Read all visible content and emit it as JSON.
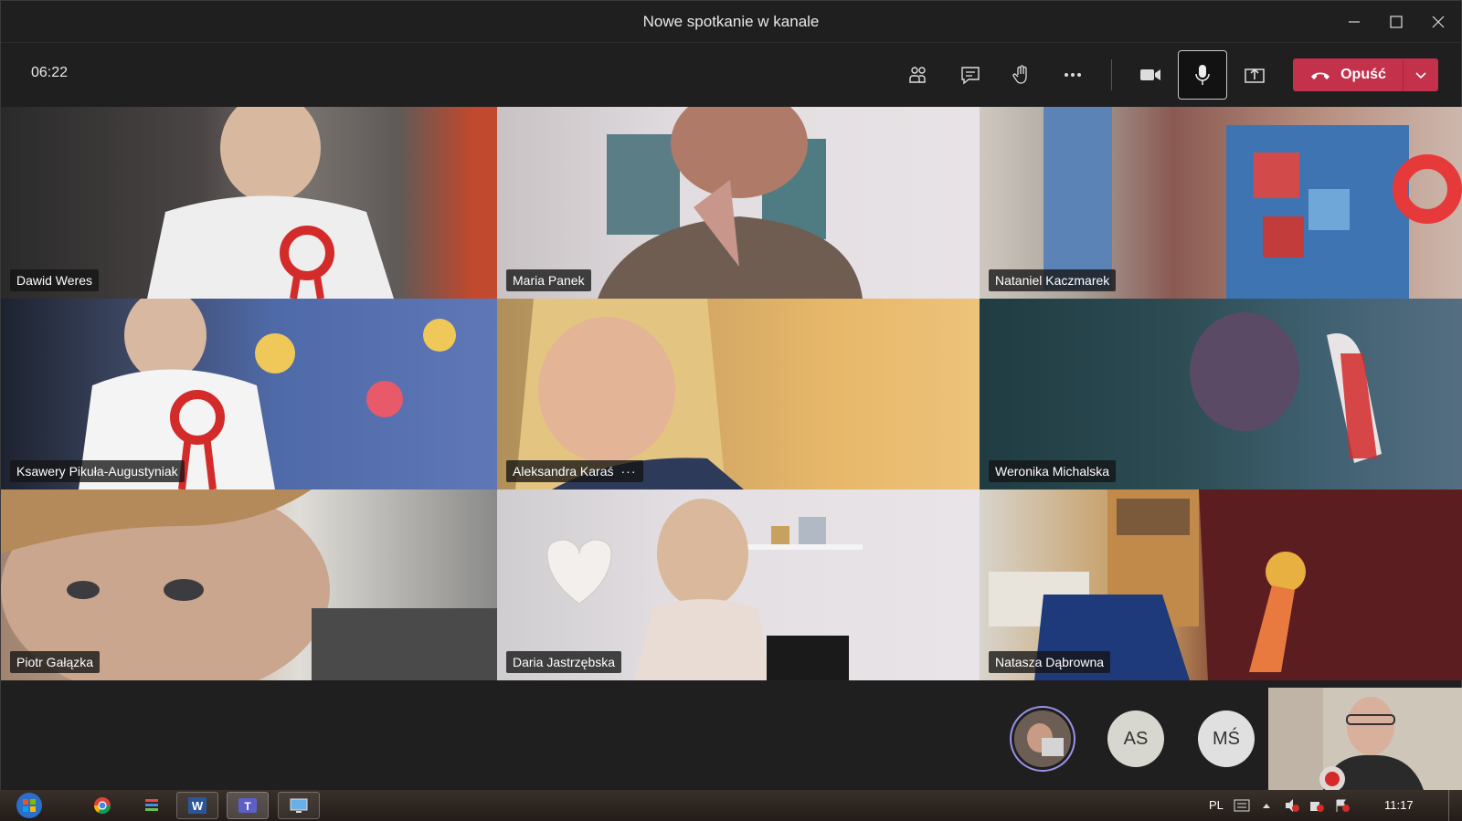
{
  "window": {
    "title": "Nowe spotkanie w kanale"
  },
  "toolbar": {
    "timer": "06:22",
    "icons": [
      "people-icon",
      "chat-icon",
      "raise-hand-icon",
      "more-icon",
      "camera-icon",
      "microphone-icon",
      "share-screen-icon"
    ],
    "leave_label": "Opuść",
    "leave_color": "#c4314b"
  },
  "participants": [
    {
      "name": "Dawid Weres"
    },
    {
      "name": "Maria Panek"
    },
    {
      "name": "Nataniel Kaczmarek"
    },
    {
      "name": "Ksawery Pikuła-Augustyniak"
    },
    {
      "name": "Aleksandra Karaś",
      "more": "···"
    },
    {
      "name": "Weronika Michalska"
    },
    {
      "name": "Piotr Gałązka"
    },
    {
      "name": "Daria Jastrzębska"
    },
    {
      "name": "Natasza Dąbrowna"
    }
  ],
  "bottom": {
    "avatars": [
      {
        "initials": "AS"
      },
      {
        "initials": "MŚ"
      }
    ],
    "ring_color": "#9a92e8"
  },
  "taskbar": {
    "language": "PL",
    "clock": "11:17",
    "apps": [
      "chrome-icon",
      "stack-icon",
      "word-icon",
      "teams-icon",
      "screen-icon"
    ]
  }
}
